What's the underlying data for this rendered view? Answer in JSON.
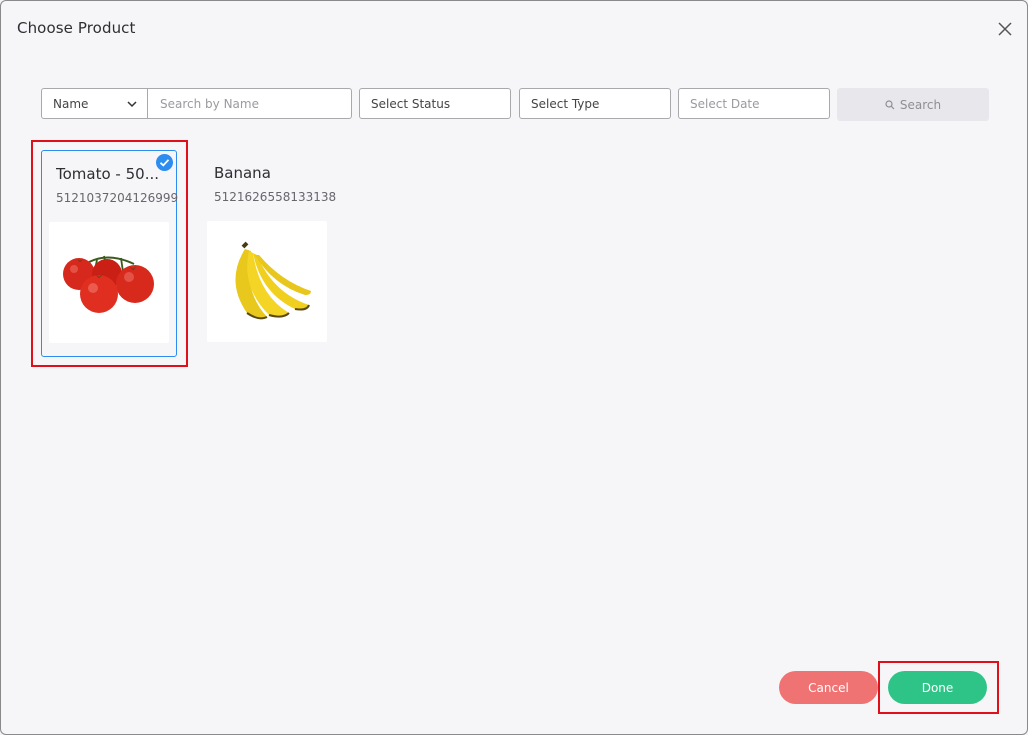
{
  "dialog": {
    "title": "Choose Product"
  },
  "filters": {
    "field_select": "Name",
    "search_placeholder": "Search by Name",
    "status_select": "Select Status",
    "type_select": "Select Type",
    "date_placeholder": "Select Date",
    "search_button": "Search"
  },
  "products": [
    {
      "name": "Tomato - 50...",
      "sku": "5121037204126999",
      "image": "tomato-image",
      "selected": true
    },
    {
      "name": "Banana",
      "sku": "5121626558133138",
      "image": "banana-image",
      "selected": false
    }
  ],
  "footer": {
    "cancel_label": "Cancel",
    "done_label": "Done"
  },
  "colors": {
    "accent_blue": "#2d8cf0",
    "cancel": "#f07373",
    "done": "#2fc487",
    "highlight": "#e0101a"
  }
}
